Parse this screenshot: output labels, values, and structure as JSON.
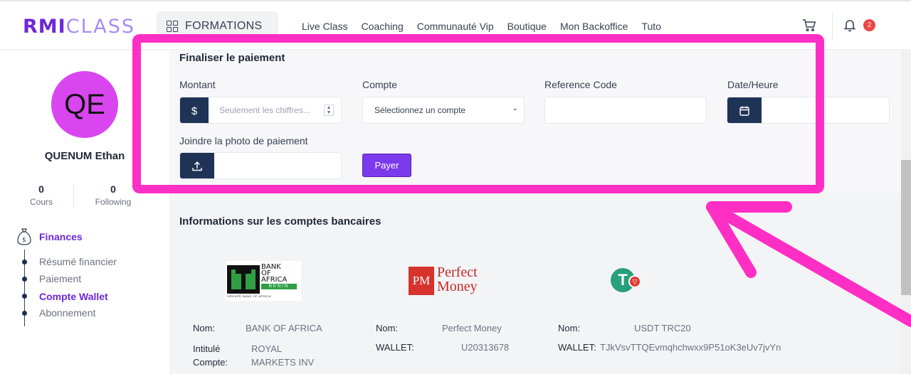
{
  "header": {
    "logo_bold": "RMI",
    "logo_thin": "CLASS",
    "formations_label": "FORMATIONS",
    "nav": [
      "Live Class",
      "Coaching",
      "Communauté Vip",
      "Boutique",
      "Mon Backoffice",
      "Tuto"
    ],
    "notif_count": "2"
  },
  "sidebar": {
    "initials": "QE",
    "name": "QUENUM Ethan",
    "stats": [
      {
        "value": "0",
        "label": "Cours"
      },
      {
        "value": "0",
        "label": "Following"
      }
    ],
    "section_title": "Finances",
    "items": [
      {
        "label": "Résumé financier",
        "active": false
      },
      {
        "label": "Paiement",
        "active": false
      },
      {
        "label": "Compte Wallet",
        "active": true
      },
      {
        "label": "Abonnement",
        "active": false
      }
    ]
  },
  "payment": {
    "title": "Finaliser le paiement",
    "montant_label": "Montant",
    "montant_placeholder": "Seulement les chiffres...",
    "currency_symbol": "$",
    "compte_label": "Compte",
    "compte_value": "Sélectionnez un compte",
    "reference_label": "Reference Code",
    "datetime_label": "Date/Heure",
    "photo_label": "Joindre la photo de paiement",
    "pay_button": "Payer"
  },
  "banks": {
    "title": "Informations sur les comptes bancaires",
    "cards": [
      {
        "logo_lines": [
          "BANK",
          "OF",
          "AFRICA",
          "BENIN"
        ],
        "logo_caption": "GROUPE BANK OF AFRICA",
        "fields": [
          {
            "label": "Nom:",
            "value": "BANK OF AFRICA"
          },
          {
            "label": "Intitulé Compte:",
            "value": "ROYAL MARKETS INV"
          }
        ]
      },
      {
        "logo_mark": "PM",
        "logo_text": [
          "Perfect",
          "Money"
        ],
        "fields": [
          {
            "label": "Nom:",
            "value": "Perfect Money"
          },
          {
            "label": "WALLET:",
            "value": "U20313678"
          }
        ]
      },
      {
        "logo_mark": "T",
        "fields": [
          {
            "label": "Nom:",
            "value": "USDT TRC20"
          },
          {
            "label": "WALLET:",
            "value": "TJkVsvTTQEvmqhchwxx9P51oK3eUv7jvYn"
          }
        ]
      }
    ]
  },
  "colors": {
    "accent": "#6d28d9",
    "highlight": "#ff2ec4",
    "addon": "#1f3356",
    "button": "#7c3aed"
  }
}
